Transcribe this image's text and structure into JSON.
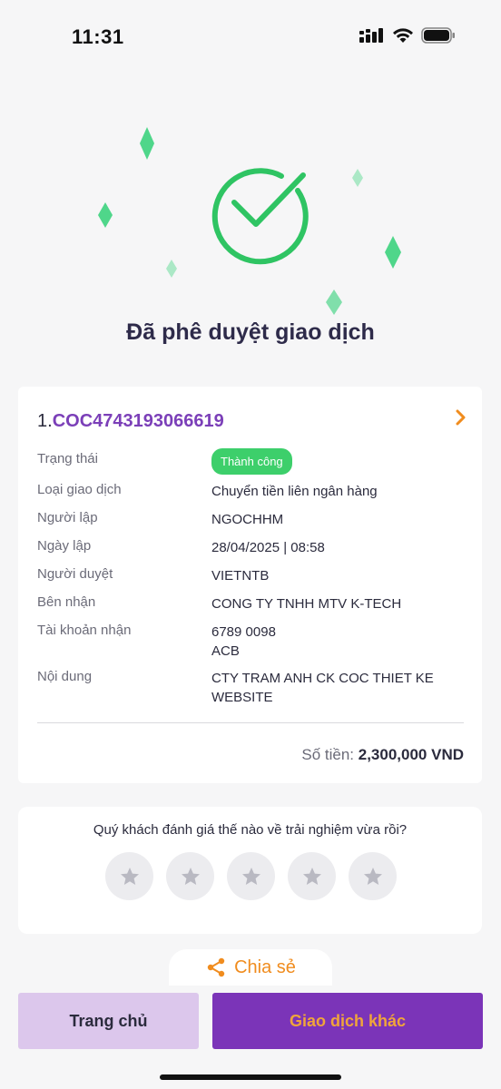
{
  "status_bar": {
    "time": "11:31"
  },
  "hero": {
    "title": "Đã phê duyệt giao dịch"
  },
  "transaction": {
    "index": "1.",
    "id": "COC4743193066619",
    "rows": [
      {
        "label": "Trạng thái",
        "value": "Thành công"
      },
      {
        "label": "Loại giao dịch",
        "value": "Chuyển tiền liên ngân hàng"
      },
      {
        "label": "Người lập",
        "value": "NGOCHHM"
      },
      {
        "label": "Ngày lập",
        "value": "28/04/2025 | 08:58"
      },
      {
        "label": "Người duyệt",
        "value": "VIETNTB"
      },
      {
        "label": "Bên nhận",
        "value": "CONG TY TNHH MTV K-TECH"
      },
      {
        "label": "Tài khoản nhận",
        "value": "6789 0098",
        "value2": "ACB"
      },
      {
        "label": "Nội dung",
        "value": "CTY TRAM ANH CK COC THIET KE WEBSITE"
      }
    ],
    "amount_label": "Số tiền:",
    "amount_value": "2,300,000 VND"
  },
  "rating": {
    "question": "Quý khách đánh giá thế nào về trải nghiệm vừa rồi?",
    "stars": 5
  },
  "share": {
    "label": "Chia sẻ"
  },
  "buttons": {
    "home": "Trang chủ",
    "other": "Giao dịch khác"
  },
  "colors": {
    "brand_purple": "#7b34b8",
    "accent_orange": "#f08c1e",
    "success_green": "#3dcf6b"
  }
}
